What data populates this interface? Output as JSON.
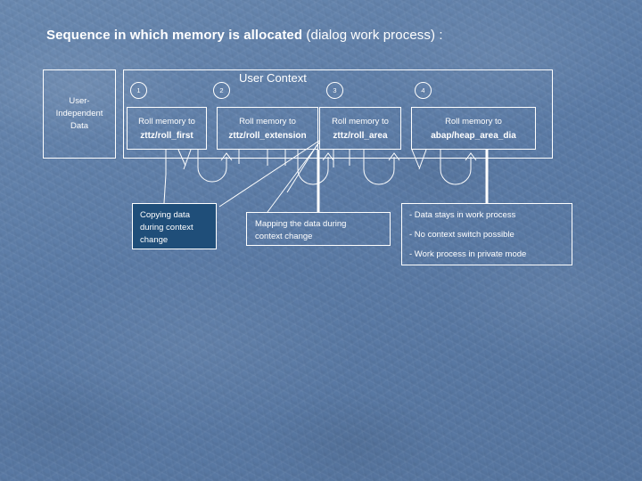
{
  "slide": {
    "title_bold": "Sequence in which memory is allocated ",
    "title_normal": "(dialog work process) :",
    "background_color": "#5c7ca6",
    "outline_color": "#ffffff",
    "fill_color": "#1f4e79"
  },
  "left_box": {
    "line1": "User-",
    "line2": "Independent",
    "line3": "Data"
  },
  "context": {
    "label": "User Context",
    "steps": [
      {
        "number": "1",
        "line1": "Roll memory to",
        "line2": "zttz/roll_first"
      },
      {
        "number": "2",
        "line1": "Roll memory to",
        "line2": "zttz/roll_extension"
      },
      {
        "number": "3",
        "line1": "Roll memory to",
        "line2": "zttz/roll_area"
      },
      {
        "number": "4",
        "line1": "Roll memory to",
        "line2": "abap/heap_area_dia"
      }
    ]
  },
  "annotations": {
    "copying": {
      "line1": "Copying data",
      "line2": "during context",
      "line3": "change"
    },
    "mapping": {
      "line1": "Mapping the data during",
      "line2": "context change"
    },
    "notes": [
      "- Data stays in work process",
      "- No context switch possible",
      "- Work process in private mode"
    ]
  }
}
